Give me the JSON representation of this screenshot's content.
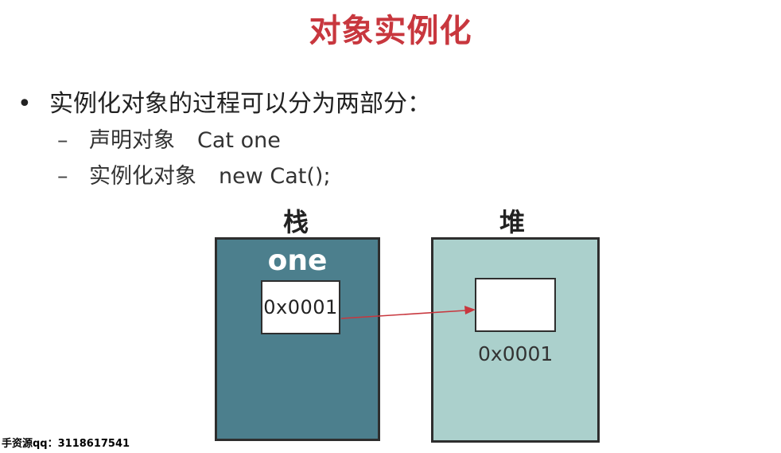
{
  "title": "对象实例化",
  "bullets": [
    {
      "text": "实例化对象的过程可以分为两部分：",
      "sub": [
        {
          "label": "声明对象",
          "code": "Cat one"
        },
        {
          "label": "实例化对象",
          "code": "new Cat();"
        }
      ]
    }
  ],
  "diagram": {
    "stack": {
      "label": "栈",
      "var_name": "one",
      "ref_value": "0x0001"
    },
    "heap": {
      "label": "堆",
      "address": "0x0001"
    }
  },
  "colors": {
    "title": "#c8373e",
    "stack_fill": "#4c7f8d",
    "heap_fill": "#abd0cc",
    "arrow": "#c8373e"
  },
  "watermark": "手资源qq：3118617541"
}
